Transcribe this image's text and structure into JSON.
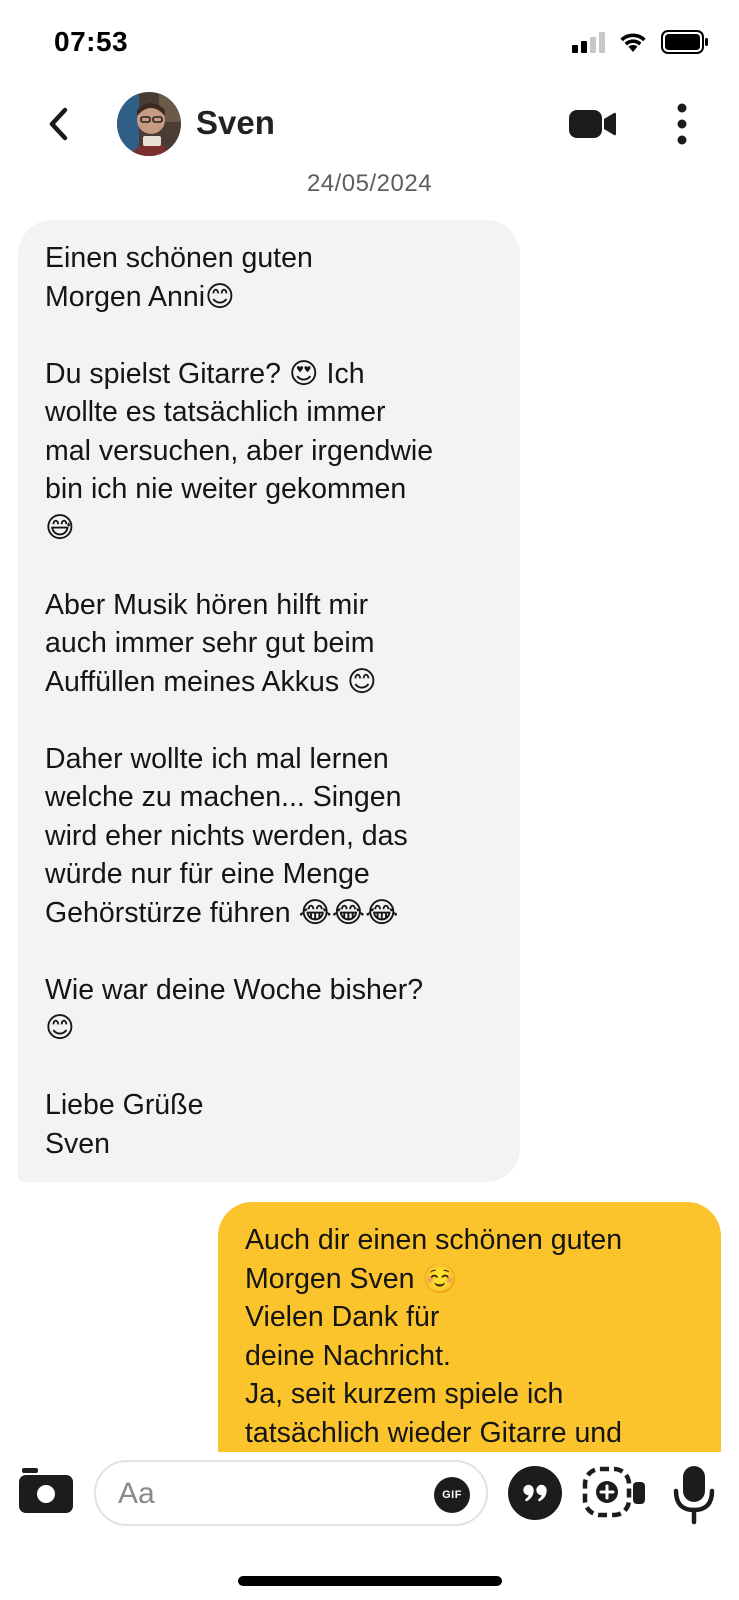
{
  "status_bar": {
    "time": "07:53"
  },
  "header": {
    "contact_name": "Sven"
  },
  "conversation": {
    "date": "24/05/2024",
    "messages": [
      {
        "direction": "incoming",
        "paragraphs": [
          "Einen schönen guten\nMorgen  Anni😊",
          "Du spielst Gitarre? 😍 Ich\nwollte es tatsächlich immer\nmal versuchen, aber irgendwie\nbin ich nie weiter gekommen\n😅",
          "Aber Musik hören hilft mir\nauch immer sehr gut beim\nAuffüllen meines Akkus 😊",
          "Daher wollte ich mal lernen\nwelche zu machen... Singen\nwird eher nichts werden, das\nwürde nur für eine Menge\nGehörstürze führen 😂😂😂",
          "Wie war deine Woche bisher?\n😊",
          "Liebe Grüße\nSven"
        ]
      },
      {
        "direction": "outgoing",
        "paragraphs": [
          "Auch dir einen schönen guten\nMorgen Sven ☺️\nVielen Dank für\ndeine Nachricht.\nJa, seit kurzem spiele ich\ntatsächlich wieder Gitarre und"
        ]
      }
    ]
  },
  "composer": {
    "placeholder": "Aa",
    "gif_label": "GIF"
  },
  "icons": {
    "back": "chevron-left-icon",
    "video_call": "video-camera-icon",
    "more": "more-vertical-icon",
    "camera": "camera-icon",
    "quote": "quote-icon",
    "video_note": "video-note-icon",
    "microphone": "microphone-icon"
  },
  "colors": {
    "incoming_bubble": "#f3f3f3",
    "outgoing_bubble": "#fcc42c",
    "icon": "#1c1c1c"
  }
}
